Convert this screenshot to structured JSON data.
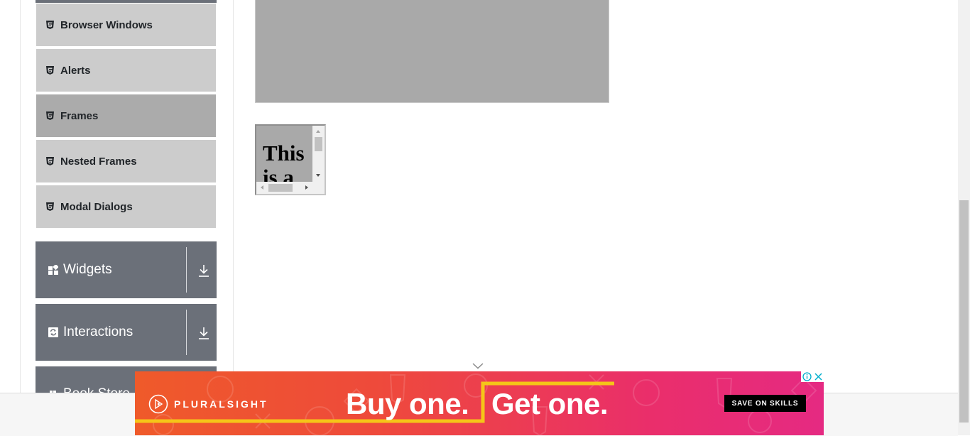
{
  "sidebar": {
    "items": [
      {
        "label": "Browser Windows",
        "active": false
      },
      {
        "label": "Alerts",
        "active": false
      },
      {
        "label": "Frames",
        "active": true
      },
      {
        "label": "Nested Frames",
        "active": false
      },
      {
        "label": "Modal Dialogs",
        "active": false
      }
    ],
    "groups": [
      {
        "label": "Widgets",
        "icon": "widgets-icon"
      },
      {
        "label": "Interactions",
        "icon": "interactions-icon"
      },
      {
        "label": "Book Store",
        "icon": "book-store-icon"
      }
    ]
  },
  "frames": {
    "small_frame_text": "This is a"
  },
  "ad": {
    "brand": "PLURALSIGHT",
    "headline_a": "Buy one.",
    "headline_b": "Get one.",
    "cta": "SAVE ON SKILLS"
  },
  "colors": {
    "menu_item_bg": "#cccccc",
    "menu_item_active_bg": "#ababab",
    "group_header_bg": "#6b7079",
    "frame_bg": "#a9a9a9",
    "ad_yellow": "#f5c518"
  }
}
